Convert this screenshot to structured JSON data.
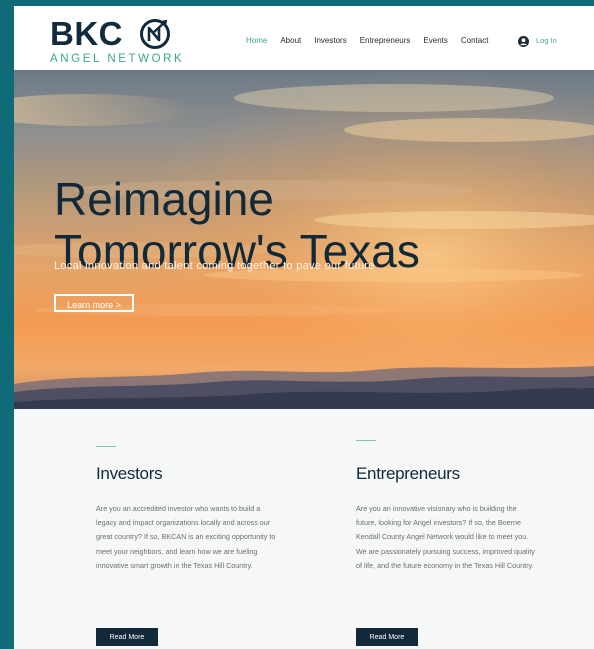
{
  "header": {
    "logo_main": "BKC",
    "logo_sub": "ANGEL NETWORK",
    "nav": [
      {
        "label": "Home",
        "active": true
      },
      {
        "label": "About",
        "active": false
      },
      {
        "label": "Investors",
        "active": false
      },
      {
        "label": "Entrepreneurs",
        "active": false
      },
      {
        "label": "Events",
        "active": false
      },
      {
        "label": "Contact",
        "active": false
      }
    ],
    "login_label": "Log In"
  },
  "hero": {
    "title_line1": "Reimagine",
    "title_line2": "Tomorrow's Texas",
    "subtitle": "Local innovation and talent coming together to pave our future",
    "button_label": "Learn more >"
  },
  "sections": {
    "investors": {
      "heading": "Investors",
      "body": "Are you an accredited investor who wants to build a legacy and impact organizations locally and across our great country?  If so, BKCAN is an exciting opportunity to meet your neighbors, and learn how we are fueling innovative smart growth in the Texas Hill Country.",
      "button_label": "Read More"
    },
    "entrepreneurs": {
      "heading": "Entrepreneurs",
      "body": "Are you an innovative visionary who is building the future, looking for Angel investors?  If so, the Boerne Kendall County Angel Network would like to meet you.  We are passionately pursuing success, improved quality of life, and the future economy in the Texas Hill Country.",
      "button_label": "Read More"
    }
  },
  "colors": {
    "brand_navy": "#12293a",
    "brand_green": "#3aa787",
    "frame_teal": "#0f6b78"
  },
  "icons": {
    "logo_mark": "angel-n-circle-icon",
    "login": "user-avatar-icon"
  }
}
